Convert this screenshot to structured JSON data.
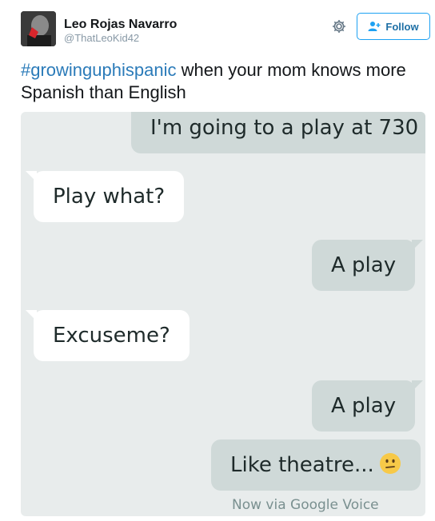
{
  "user": {
    "display_name": "Leo Rojas Navarro",
    "handle": "@ThatLeoKid42"
  },
  "actions": {
    "follow_label": "Follow",
    "settings_icon": "gear-icon",
    "follow_icon": "add-user-icon"
  },
  "tweet": {
    "hashtag": "#growinguphispanic",
    "text_rest": " when your mom knows more Spanish than English"
  },
  "conversation": {
    "messages": [
      {
        "direction": "outgoing",
        "text": "I'm going to a play at 730"
      },
      {
        "direction": "incoming",
        "text": "Play what?"
      },
      {
        "direction": "outgoing",
        "text": "A play"
      },
      {
        "direction": "incoming",
        "text": "Excuseme?"
      },
      {
        "direction": "outgoing",
        "text": "A play"
      },
      {
        "direction": "outgoing",
        "text": "Like theatre...",
        "emoji": "neutral-face-emoji"
      }
    ],
    "status": "Now via Google Voice"
  },
  "colors": {
    "link": "#2b7bb9",
    "follow_border": "#1da1f2",
    "outgoing_bubble": "#cfd9d8",
    "incoming_bubble": "#ffffff",
    "chat_background": "#e8ecec"
  }
}
